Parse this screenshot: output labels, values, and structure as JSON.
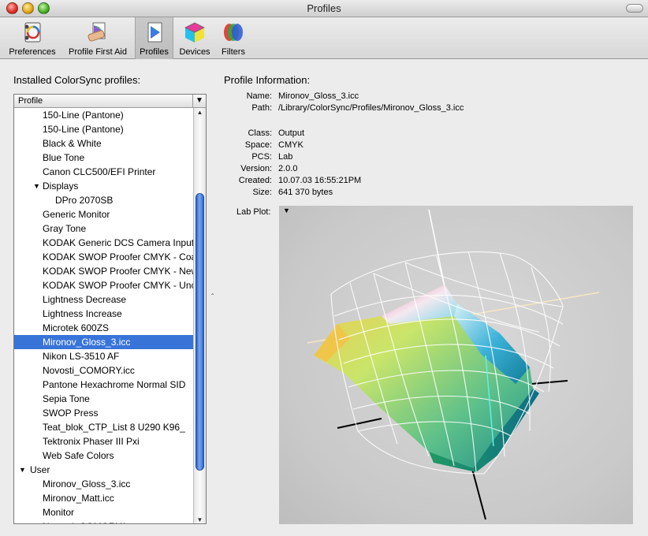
{
  "window": {
    "title": "Profiles"
  },
  "toolbar": {
    "items": [
      {
        "label": "Preferences",
        "icon": "preferences-icon"
      },
      {
        "label": "Profile First Aid",
        "icon": "first-aid-icon"
      },
      {
        "label": "Profiles",
        "icon": "profiles-icon",
        "selected": true
      },
      {
        "label": "Devices",
        "icon": "devices-icon"
      },
      {
        "label": "Filters",
        "icon": "filters-icon"
      }
    ]
  },
  "left": {
    "heading": "Installed ColorSync profiles:",
    "column_header": "Profile",
    "rows": [
      {
        "label": "150-Line (Pantone)",
        "indent": 2
      },
      {
        "label": "150-Line (Pantone)",
        "indent": 2
      },
      {
        "label": "Black & White",
        "indent": 2
      },
      {
        "label": "Blue Tone",
        "indent": 2
      },
      {
        "label": "Canon CLC500/EFI Printer",
        "indent": 2
      },
      {
        "label": "Displays",
        "indent": 2,
        "group": true
      },
      {
        "label": "DPro 2070SB",
        "indent": 3
      },
      {
        "label": "Generic Monitor",
        "indent": 2
      },
      {
        "label": "Gray Tone",
        "indent": 2
      },
      {
        "label": "KODAK Generic DCS Camera Input",
        "indent": 2
      },
      {
        "label": "KODAK SWOP Proofer CMYK - Coated",
        "indent": 2
      },
      {
        "label": "KODAK SWOP Proofer CMYK - Newsprint",
        "indent": 2
      },
      {
        "label": "KODAK SWOP Proofer CMYK - Uncoated",
        "indent": 2
      },
      {
        "label": "Lightness Decrease",
        "indent": 2
      },
      {
        "label": "Lightness Increase",
        "indent": 2
      },
      {
        "label": "Microtek 600ZS",
        "indent": 2
      },
      {
        "label": "Mironov_Gloss_3.icc",
        "indent": 2,
        "selected": true
      },
      {
        "label": "Nikon LS-3510 AF",
        "indent": 2
      },
      {
        "label": "Novosti_COMORY.icc",
        "indent": 2
      },
      {
        "label": "Pantone Hexachrome Normal SID",
        "indent": 2
      },
      {
        "label": "Sepia Tone",
        "indent": 2
      },
      {
        "label": "SWOP Press",
        "indent": 2
      },
      {
        "label": "Teat_blok_CTP_List 8 U290 K96_",
        "indent": 2
      },
      {
        "label": "Tektronix Phaser III Pxi",
        "indent": 2
      },
      {
        "label": "Web Safe Colors",
        "indent": 2
      },
      {
        "label": "User",
        "indent": 1,
        "group": true
      },
      {
        "label": "Mironov_Gloss_3.icc",
        "indent": 2
      },
      {
        "label": "Mironov_Matt.icc",
        "indent": 2
      },
      {
        "label": "Monitor",
        "indent": 2
      },
      {
        "label": "Novosti_COMORY.icc",
        "indent": 2
      }
    ]
  },
  "info": {
    "heading": "Profile Information:",
    "name_label": "Name:",
    "name": "Mironov_Gloss_3.icc",
    "path_label": "Path:",
    "path": "/Library/ColorSync/Profiles/Mironov_Gloss_3.icc",
    "class_label": "Class:",
    "class": "Output",
    "space_label": "Space:",
    "space": "CMYK",
    "pcs_label": "PCS:",
    "pcs": "Lab",
    "version_label": "Version:",
    "version": "2.0.0",
    "created_label": "Created:",
    "created": "10.07.03 16:55:21PM",
    "size_label": "Size:",
    "size": "641 370 bytes",
    "plot_label": "Lab Plot:"
  },
  "colors": {
    "selection": "#3874d8",
    "scroll_thumb": "#2b62c9"
  }
}
